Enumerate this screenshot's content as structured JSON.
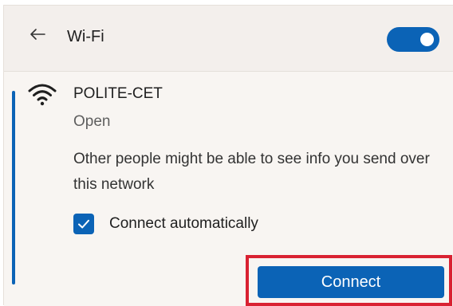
{
  "header": {
    "title": "Wi-Fi",
    "back_icon": "back-arrow-icon",
    "toggle": {
      "state": "on",
      "accent_color": "#0b63b6"
    }
  },
  "network": {
    "name": "POLITE-CET",
    "status": "Open",
    "warning": "Other people might be able to see info you send over this network",
    "icon": "wifi-icon",
    "connect_automatically": {
      "label": "Connect automatically",
      "checked": true
    },
    "connect_button": {
      "label": "Connect",
      "highlight_color": "#d92232"
    }
  }
}
